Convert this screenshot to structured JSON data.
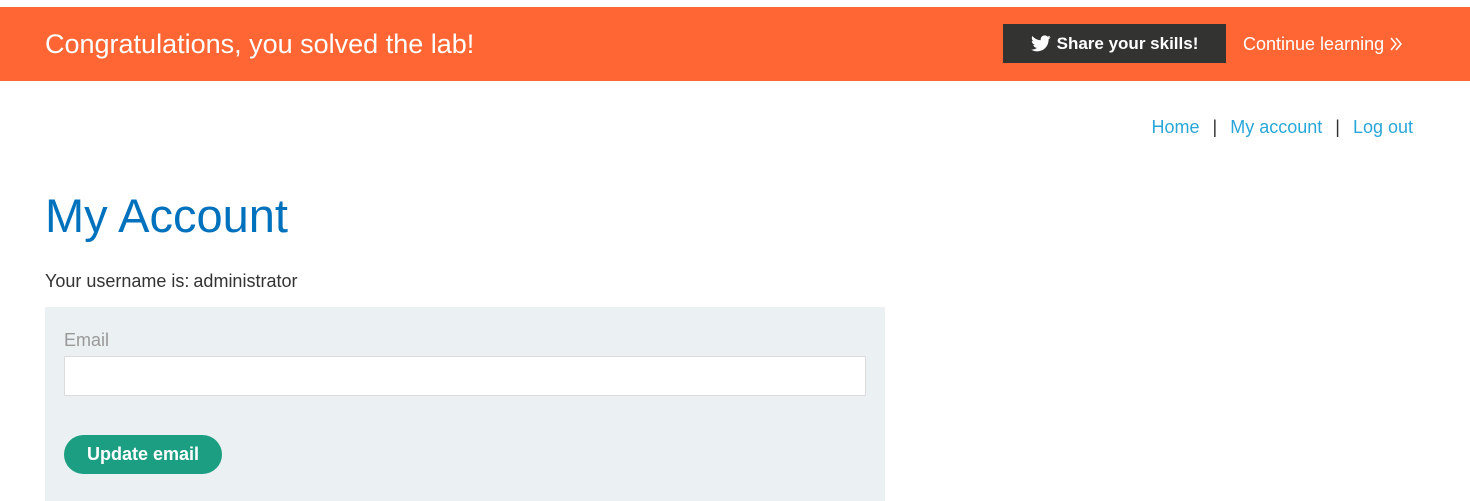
{
  "banner": {
    "title": "Congratulations, you solved the lab!",
    "share_label": "Share your skills!",
    "share_icon": "twitter-icon",
    "continue_label": "Continue learning",
    "continue_icon": "double-chevron-right-icon",
    "background_color": "#ff6633"
  },
  "nav": {
    "home": "Home",
    "my_account": "My account",
    "log_out": "Log out",
    "separator": "|",
    "link_color": "#29a7d8"
  },
  "main": {
    "title": "My Account",
    "username_label": "Your username is:",
    "username_value": "administrator",
    "title_color": "#0071bc"
  },
  "form": {
    "email_label": "Email",
    "email_value": "",
    "email_placeholder": "",
    "submit_label": "Update email",
    "submit_color": "#1b9e82",
    "panel_color": "#ebf0f2"
  }
}
